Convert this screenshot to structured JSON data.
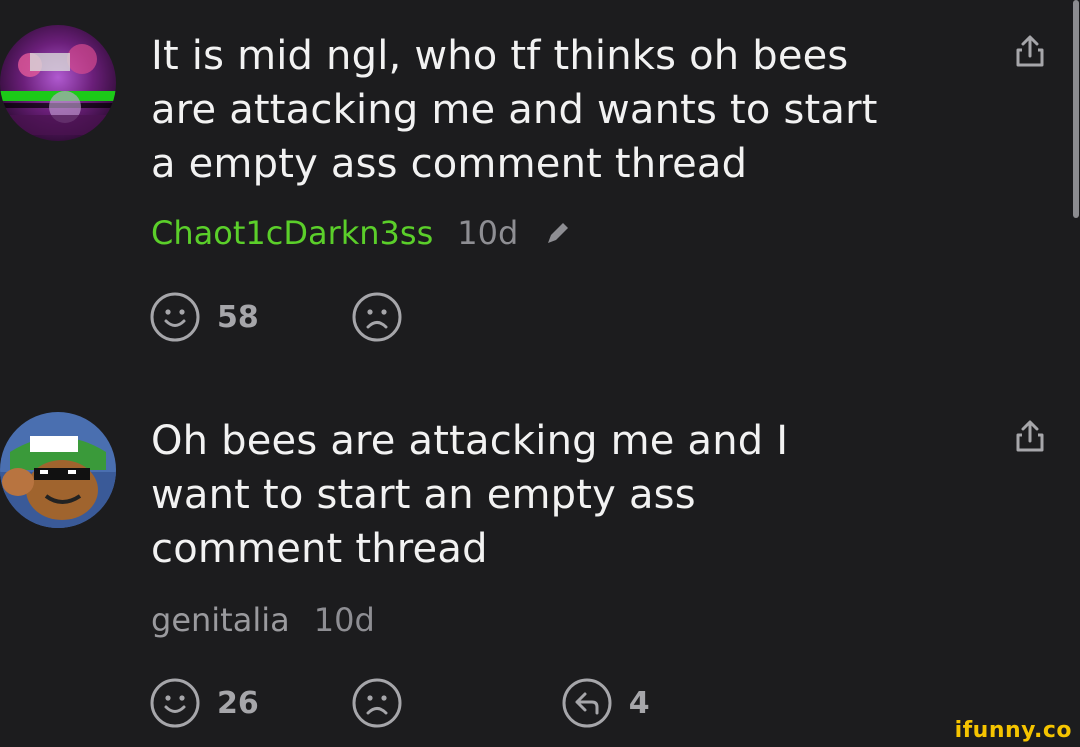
{
  "comments": [
    {
      "text": "It is mid ngl, who tf thinks oh bees\nare attacking me and wants to start\na empty ass comment thread",
      "username": "Chaot1cDarkn3ss",
      "time": "10d",
      "likes": "58",
      "edited_icon": "pencil-icon",
      "username_color": "#5bcf2a"
    },
    {
      "text": "Oh bees are attacking me and I\nwant to start an empty ass\ncomment thread",
      "username": "genitalia",
      "time": "10d",
      "likes": "26",
      "replies": "4",
      "username_color": "#9a9a9e"
    }
  ],
  "icons": {
    "like": "smiley-icon",
    "dislike": "frown-icon",
    "reply": "reply-icon",
    "share": "share-icon"
  },
  "watermark": "ifunny.co",
  "colors": {
    "background": "#1c1c1e",
    "icon": "#a6a6aa",
    "watermark": "#f5c400"
  }
}
